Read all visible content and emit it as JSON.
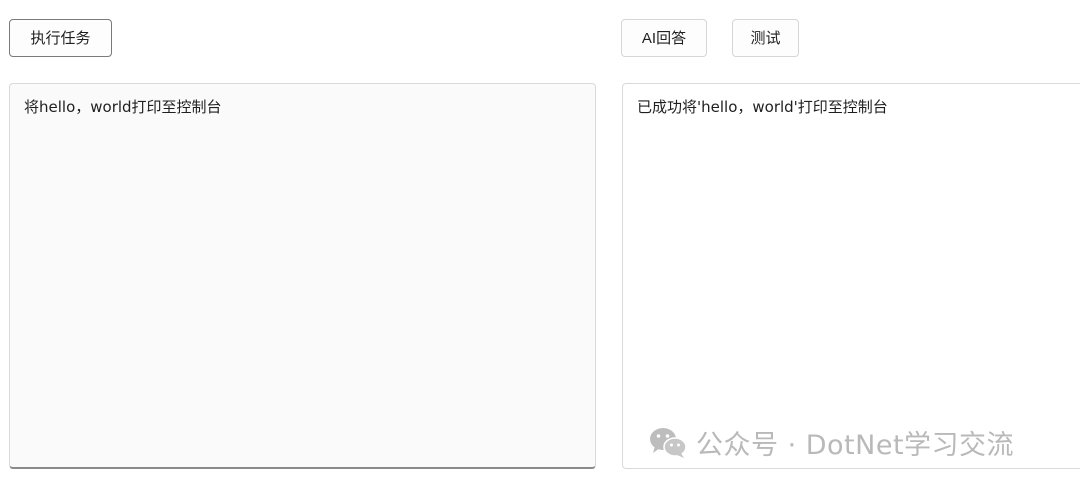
{
  "toolbar": {
    "execute_label": "执行任务",
    "ai_answer_label": "AI回答",
    "test_label": "测试"
  },
  "input_pane": {
    "text": "将hello，world打印至控制台"
  },
  "output_pane": {
    "text": "已成功将'hello，world'打印至控制台"
  },
  "watermark": {
    "icon": "wechat-icon",
    "text": "公众号 · DotNet学习交流",
    "color": "#b9b9b9"
  }
}
